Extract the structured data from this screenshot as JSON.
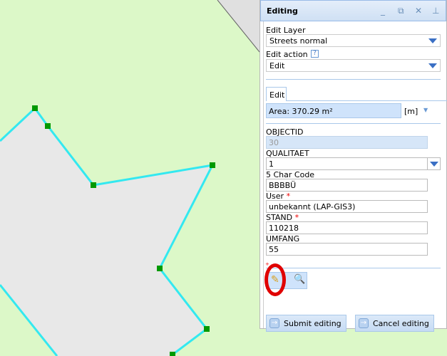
{
  "panel": {
    "title": "Editing",
    "edit_layer_label": "Edit Layer",
    "edit_layer_value": "Streets normal",
    "edit_action_label": "Edit action",
    "edit_action_help": "?",
    "edit_action_value": "Edit",
    "tab_edit": "Edit",
    "area_text": "Area: 370.29 m²",
    "unit": "[m]",
    "fields": [
      {
        "label": "OBJECTID",
        "value": "30",
        "required": false
      },
      {
        "label": "QUALITAET",
        "value": "1",
        "required": false
      },
      {
        "label": "5 Char Code",
        "value": "BBBBÜ",
        "required": false
      },
      {
        "label": "User",
        "value": "unbekannt (LAP-GIS3)",
        "required": true
      },
      {
        "label": "STAND",
        "value": "110218",
        "required": true
      },
      {
        "label": "UMFANG",
        "value": "55",
        "required": false
      }
    ],
    "required_mark": "*",
    "submit_label": "Submit editing",
    "cancel_label": "Cancel editing"
  },
  "colors": {
    "map_bg": "#dcf8c8",
    "polygon_fill": "#e8e8e8",
    "polygon_stroke": "#33e8f0",
    "vertex": "#009900",
    "annotation": "#e00000"
  }
}
